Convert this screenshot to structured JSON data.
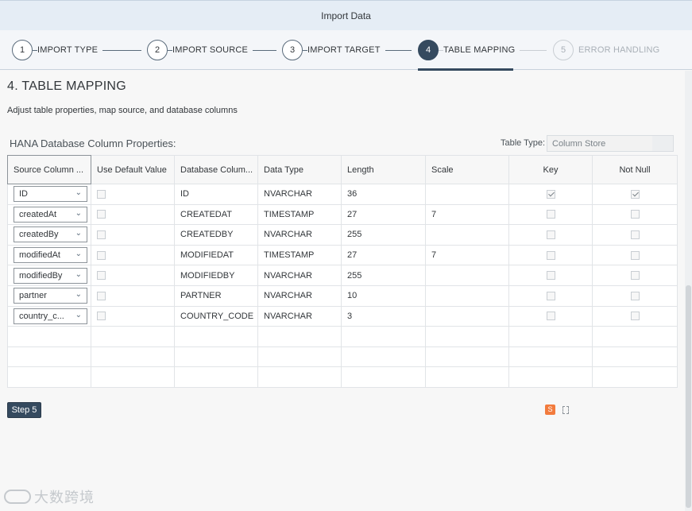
{
  "window": {
    "title": "Import Data"
  },
  "wizard": {
    "steps": [
      {
        "number": "1",
        "label": "IMPORT TYPE",
        "state": "done"
      },
      {
        "number": "2",
        "label": "IMPORT SOURCE",
        "state": "done"
      },
      {
        "number": "3",
        "label": "IMPORT TARGET",
        "state": "done"
      },
      {
        "number": "4",
        "label": "TABLE MAPPING",
        "state": "active"
      },
      {
        "number": "5",
        "label": "ERROR HANDLING",
        "state": "disabled"
      }
    ]
  },
  "page": {
    "title": "4. TABLE MAPPING",
    "subtitle": "Adjust table properties, map source, and database columns",
    "properties_label": "HANA Database Column Properties:",
    "table_type_label": "Table Type:",
    "table_type_value": "Column Store"
  },
  "table": {
    "headers": [
      "Source Column ...",
      "Use Default Value",
      "Database Colum...",
      "Data Type",
      "Length",
      "Scale",
      "Key",
      "Not Null"
    ],
    "rows": [
      {
        "source": "ID",
        "use_default": false,
        "db_column": "ID",
        "data_type": "NVARCHAR",
        "length": "36",
        "scale": "",
        "key": true,
        "not_null": true
      },
      {
        "source": "createdAt",
        "use_default": false,
        "db_column": "CREATEDAT",
        "data_type": "TIMESTAMP",
        "length": "27",
        "scale": "7",
        "key": false,
        "not_null": false
      },
      {
        "source": "createdBy",
        "use_default": false,
        "db_column": "CREATEDBY",
        "data_type": "NVARCHAR",
        "length": "255",
        "scale": "",
        "key": false,
        "not_null": false
      },
      {
        "source": "modifiedAt",
        "use_default": false,
        "db_column": "MODIFIEDAT",
        "data_type": "TIMESTAMP",
        "length": "27",
        "scale": "7",
        "key": false,
        "not_null": false
      },
      {
        "source": "modifiedBy",
        "use_default": false,
        "db_column": "MODIFIEDBY",
        "data_type": "NVARCHAR",
        "length": "255",
        "scale": "",
        "key": false,
        "not_null": false
      },
      {
        "source": "partner",
        "use_default": false,
        "db_column": "PARTNER",
        "data_type": "NVARCHAR",
        "length": "10",
        "scale": "",
        "key": false,
        "not_null": false
      },
      {
        "source": "country_c...",
        "use_default": false,
        "db_column": "COUNTRY_CODE",
        "data_type": "NVARCHAR",
        "length": "3",
        "scale": "",
        "key": false,
        "not_null": false
      }
    ],
    "empty_rows": 3
  },
  "footer": {
    "step_button": "Step 5"
  },
  "tray": {
    "s_icon": "S"
  },
  "watermark": {
    "text": "大数跨境"
  },
  "colors": {
    "accent": "#354a5f",
    "titlebar": "#e5edf5",
    "background": "#f7f7f7"
  }
}
